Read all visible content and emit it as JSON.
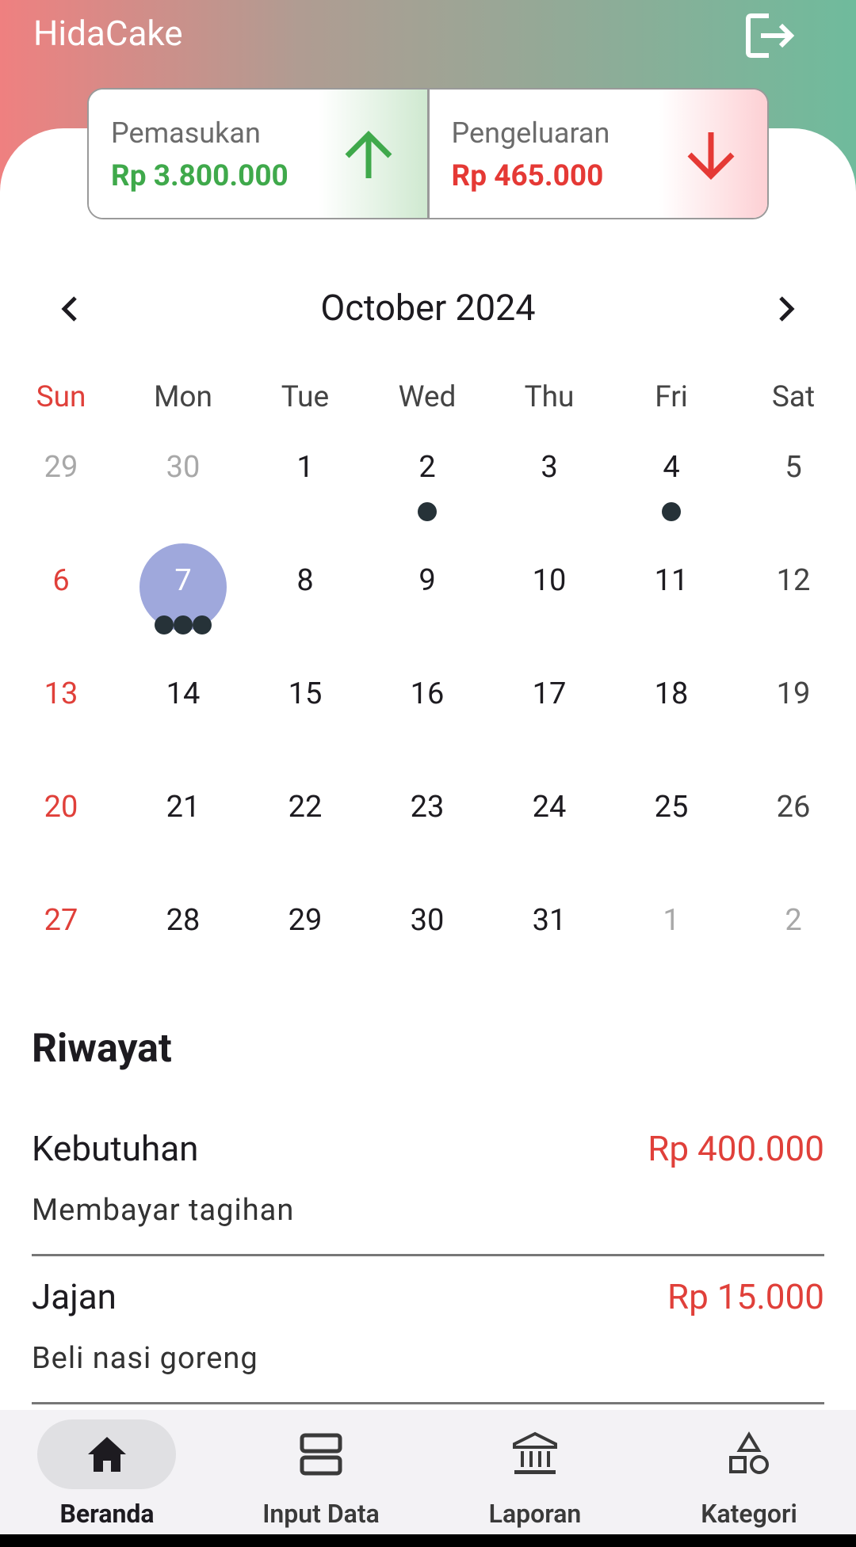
{
  "app": {
    "title": "HidaCake"
  },
  "summary": {
    "income_label": "Pemasukan",
    "income_value": "Rp 3.800.000",
    "expense_label": "Pengeluaran",
    "expense_value": "Rp 465.000",
    "income_color": "#3fa94b",
    "expense_color": "#e53935"
  },
  "calendar": {
    "month_label": "October 2024",
    "weekdays": [
      "Sun",
      "Mon",
      "Tue",
      "Wed",
      "Thu",
      "Fri",
      "Sat"
    ],
    "selected_day": 7,
    "selected_color": "#9fa8dc",
    "weeks": [
      [
        {
          "d": "29",
          "other": true
        },
        {
          "d": "30",
          "other": true
        },
        {
          "d": "1"
        },
        {
          "d": "2",
          "dots": 1
        },
        {
          "d": "3"
        },
        {
          "d": "4",
          "dots": 1
        },
        {
          "d": "5"
        }
      ],
      [
        {
          "d": "6"
        },
        {
          "d": "7",
          "sel": true,
          "dots": 3
        },
        {
          "d": "8"
        },
        {
          "d": "9"
        },
        {
          "d": "10"
        },
        {
          "d": "11"
        },
        {
          "d": "12"
        }
      ],
      [
        {
          "d": "13"
        },
        {
          "d": "14"
        },
        {
          "d": "15"
        },
        {
          "d": "16"
        },
        {
          "d": "17"
        },
        {
          "d": "18"
        },
        {
          "d": "19"
        }
      ],
      [
        {
          "d": "20"
        },
        {
          "d": "21"
        },
        {
          "d": "22"
        },
        {
          "d": "23"
        },
        {
          "d": "24"
        },
        {
          "d": "25"
        },
        {
          "d": "26"
        }
      ],
      [
        {
          "d": "27"
        },
        {
          "d": "28"
        },
        {
          "d": "29"
        },
        {
          "d": "30"
        },
        {
          "d": "31"
        },
        {
          "d": "1",
          "other": true
        },
        {
          "d": "2",
          "other": true
        }
      ]
    ]
  },
  "history": {
    "title": "Riwayat",
    "items": [
      {
        "category": "Kebutuhan",
        "amount": "Rp 400.000",
        "description": "Membayar tagihan"
      },
      {
        "category": "Jajan",
        "amount": "Rp 15.000",
        "description": "Beli nasi goreng"
      }
    ]
  },
  "nav": {
    "items": [
      {
        "label": "Beranda",
        "icon": "home-icon",
        "active": true
      },
      {
        "label": "Input Data",
        "icon": "input-data-icon",
        "active": false
      },
      {
        "label": "Laporan",
        "icon": "bank-icon",
        "active": false
      },
      {
        "label": "Kategori",
        "icon": "category-shapes-icon",
        "active": false
      }
    ]
  }
}
